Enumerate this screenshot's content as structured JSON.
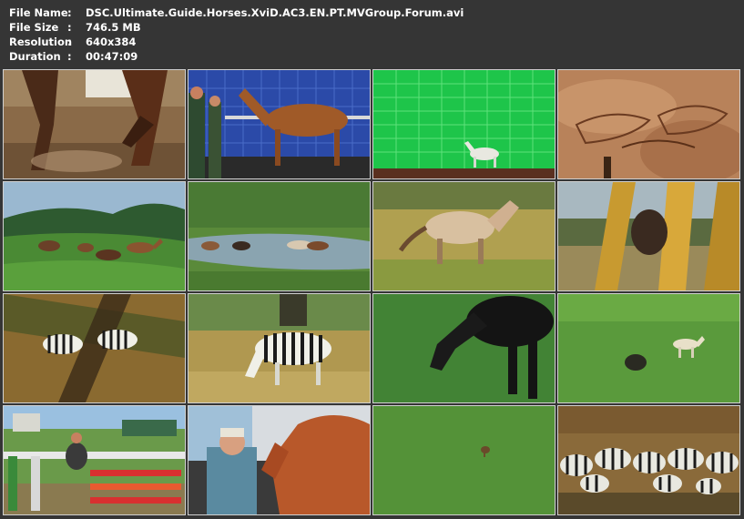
{
  "info": {
    "name_label": "File Name",
    "name_value": "DSC.Ultimate.Guide.Horses.XviD.AC3.EN.PT.MVGroup.Forum.avi",
    "size_label": "File Size",
    "size_value": "746.5 MB",
    "resolution_label": "Resolution",
    "resolution_value": "640x384",
    "duration_label": "Duration",
    "duration_value": "00:47:09",
    "separator": ":"
  },
  "thumbnails": [
    {
      "scene": "galloping-horses-legs-dust"
    },
    {
      "scene": "horse-on-treadmill-blue-wall"
    },
    {
      "scene": "white-horse-green-screen"
    },
    {
      "scene": "cave-painting-horses"
    },
    {
      "scene": "horses-grazing-hillside"
    },
    {
      "scene": "horses-at-watering-hole"
    },
    {
      "scene": "przewalski-horse-running"
    },
    {
      "scene": "horse-behind-trees"
    },
    {
      "scene": "zebras-running-blurred"
    },
    {
      "scene": "zebra-grazing"
    },
    {
      "scene": "black-horse-grazing"
    },
    {
      "scene": "animals-on-green-field"
    },
    {
      "scene": "show-jumping-arena"
    },
    {
      "scene": "man-with-chestnut-horse"
    },
    {
      "scene": "small-animal-in-grass"
    },
    {
      "scene": "zebra-herd-drinking"
    }
  ]
}
